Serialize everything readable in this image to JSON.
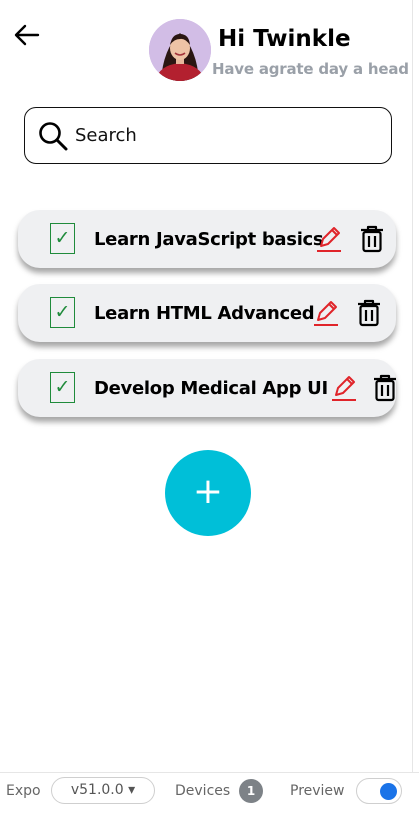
{
  "header": {
    "greeting": "Hi Twinkle",
    "subtitle": "Have agrate day a head"
  },
  "search": {
    "placeholder": "Search",
    "value": ""
  },
  "todos": [
    {
      "title": "Learn JavaScript basics",
      "checked": true
    },
    {
      "title": "Learn HTML Advanced",
      "checked": true
    },
    {
      "title": "Develop Medical App UI",
      "checked": true
    }
  ],
  "fab": {
    "label": "+"
  },
  "bottom_bar": {
    "expo_label": "Expo",
    "version": "v51.0.0 ▾",
    "devices_label": "Devices",
    "devices_count": "1",
    "preview_label": "Preview",
    "preview_on": true
  },
  "colors": {
    "accent": "#00bfd8",
    "check": "#1f8b3b",
    "edit": "#e0242a",
    "subtitle": "#9aa0a8",
    "card": "#eff0f2",
    "toggle": "#1a73e8"
  },
  "icons": {
    "back": "arrow-left-icon",
    "search": "search-icon",
    "check": "checkmark-icon",
    "edit": "pencil-icon",
    "delete": "trash-icon"
  }
}
